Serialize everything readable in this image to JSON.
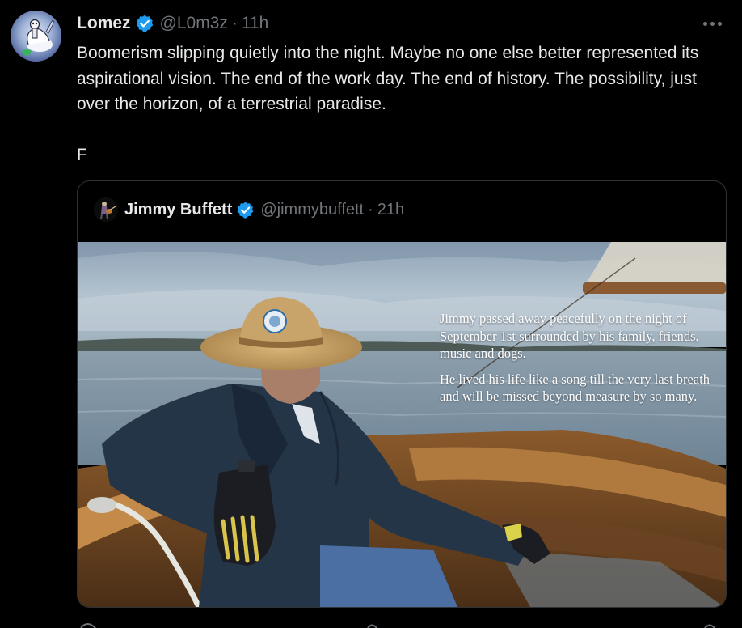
{
  "author": {
    "name": "Lomez",
    "handle": "@L0m3z",
    "time": "11h",
    "dot": "·",
    "avatar_icon": "skeleton-rider-avatar"
  },
  "tweet": {
    "text": "Boomerism slipping quietly into the night. Maybe no one else better represented its aspirational vision. The end of the work day. The end of history. The possibility, just over the horizon, of a terrestrial paradise.",
    "sign_off": "F"
  },
  "quoted": {
    "name": "Jimmy Buffett",
    "handle": "@jimmybuffett",
    "time": "21h",
    "dot": "·",
    "avatar_icon": "guitar-player-avatar",
    "image_caption": [
      "Jimmy passed away peacefully on the night of September 1st surrounded by his family, friends, music and dogs.",
      "He lived his life like a song till the very last breath and will be missed beyond measure by so many."
    ]
  },
  "colors": {
    "background": "#000000",
    "text_primary": "#e7e9ea",
    "text_secondary": "#71767b",
    "verified_blue": "#1d9bf0",
    "border": "#2f3336"
  },
  "icons": {
    "verified": "verified-badge-icon",
    "more": "more-options-icon"
  }
}
